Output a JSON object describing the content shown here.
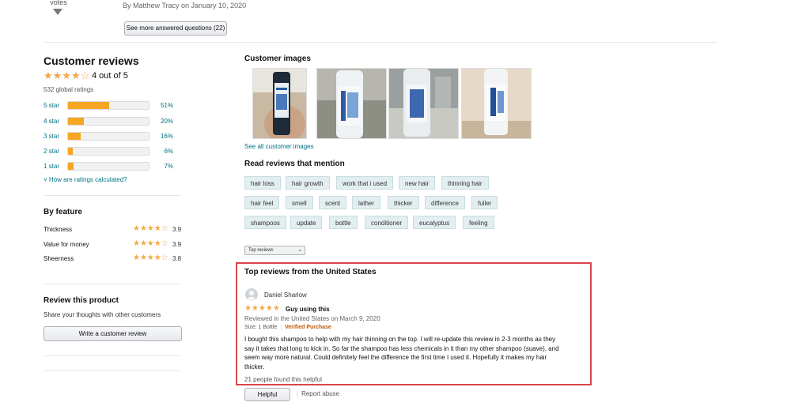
{
  "qa": {
    "votes_label": "votes",
    "answered_by": "By Matthew Tracy on January 10, 2020",
    "see_more_button": "See more answered questions (22)"
  },
  "summary": {
    "title": "Customer reviews",
    "overall_text": "4 out of 5",
    "overall_rating": 4,
    "global_ratings": "532 global ratings",
    "histogram": [
      {
        "label": "5 star",
        "percent_text": "51%",
        "fill": 0.51
      },
      {
        "label": "4 star",
        "percent_text": "20%",
        "fill": 0.2
      },
      {
        "label": "3 star",
        "percent_text": "16%",
        "fill": 0.16
      },
      {
        "label": "2 star",
        "percent_text": "6%",
        "fill": 0.06
      },
      {
        "label": "1 star",
        "percent_text": "7%",
        "fill": 0.07
      }
    ],
    "how_calculated_link": "How are ratings calculated?"
  },
  "by_feature": {
    "title": "By feature",
    "items": [
      {
        "name": "Thickness",
        "value": "3.9"
      },
      {
        "name": "Value for money",
        "value": "3.9"
      },
      {
        "name": "Sheerness",
        "value": "3.8"
      }
    ]
  },
  "review_product": {
    "title": "Review this product",
    "subtitle": "Share your thoughts with other customers",
    "button": "Write a customer review"
  },
  "customer_images": {
    "title": "Customer images",
    "see_all_link": "See all customer images"
  },
  "mentions": {
    "title": "Read reviews that mention",
    "rows": [
      [
        "hair loss",
        "hair growth",
        "work that i used",
        "new hair",
        "thinning hair"
      ],
      [
        "hair feel",
        "smell",
        "scent",
        "lather",
        "thicker",
        "difference",
        "fuller"
      ],
      [
        "shampoos",
        "update",
        "bottle",
        "conditioner",
        "eucalyptus",
        "feeling"
      ]
    ]
  },
  "sort": {
    "selected": "Top reviews"
  },
  "top_reviews": {
    "title": "Top reviews from the United States",
    "review": {
      "reviewer": "Daniel Sharlow",
      "rating": 5,
      "headline": "Guy using this",
      "date": "Reviewed in the United States on March 9, 2020",
      "size": "Size: 1 Bottle",
      "verified": "Verified Purchase",
      "body": "I bought this shampoo to help with my hair thinning on the top. I will re-update this review in 2-3 months as they say it takes that long to kick in. So far the shampoo has less chemicals in it than my other shampoo (suave), and seem way more natural. Could definitely feel the difference the first time I used it. Hopefully it makes my hair thicker.",
      "helpful_count": "21 people found this helpful",
      "helpful_button": "Helpful",
      "report_link": "Report abuse"
    }
  },
  "colors": {
    "star": "#f3a847",
    "link": "#007185",
    "highlight_box": "#d9454d"
  }
}
